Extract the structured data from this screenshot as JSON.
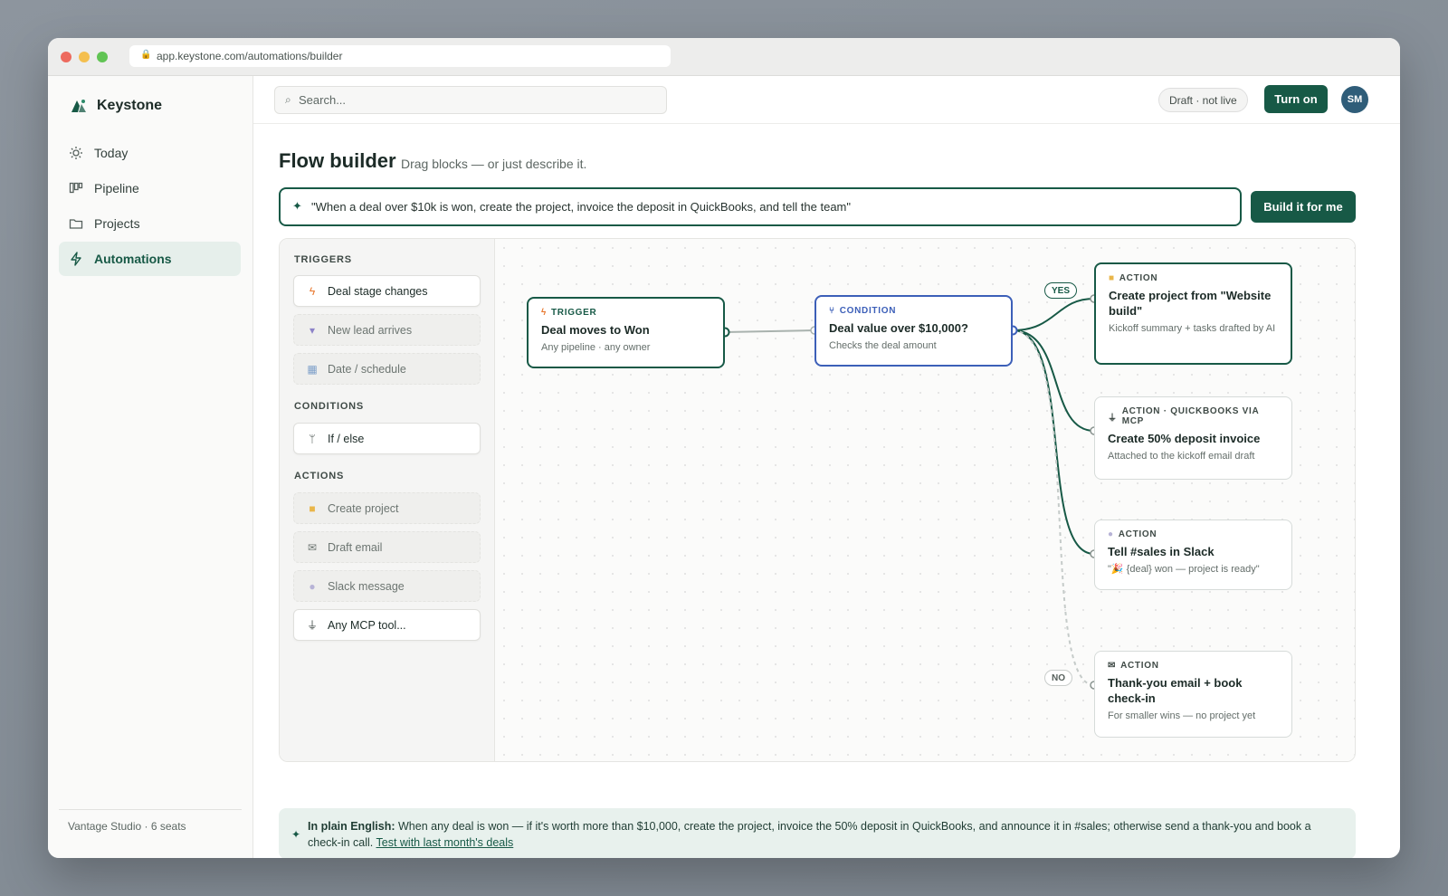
{
  "browser": {
    "url": "app.keystone.com/automations/builder"
  },
  "sidebar": {
    "brand": "Keystone",
    "items": [
      {
        "label": "Today",
        "icon": "sun-icon"
      },
      {
        "label": "Pipeline",
        "icon": "kanban-icon"
      },
      {
        "label": "Projects",
        "icon": "folder-icon"
      },
      {
        "label": "Automations",
        "icon": "bolt-icon",
        "active": true
      }
    ],
    "workspace": "Vantage Studio · 6 seats"
  },
  "topbar": {
    "search_placeholder": "Search...",
    "status": "Draft · not live",
    "turn_on": "Turn on",
    "avatar": "SM"
  },
  "page": {
    "title": "Flow builder",
    "subtitle": "Drag blocks — or just describe it.",
    "prompt": "\"When a deal over $10k is won, create the project, invoice the deposit in QuickBooks, and tell the team\"",
    "build_button": "Build it for me"
  },
  "palette": {
    "triggers_title": "TRIGGERS",
    "triggers": [
      {
        "label": "Deal stage changes",
        "icon": "bolt-icon",
        "enabled": true
      },
      {
        "label": "New lead arrives",
        "icon": "inbox-icon",
        "enabled": false
      },
      {
        "label": "Date / schedule",
        "icon": "calendar-icon",
        "enabled": false
      }
    ],
    "conditions_title": "CONDITIONS",
    "conditions": [
      {
        "label": "If / else",
        "icon": "branch-icon",
        "enabled": true
      }
    ],
    "actions_title": "ACTIONS",
    "actions": [
      {
        "label": "Create project",
        "icon": "folder-icon",
        "enabled": false
      },
      {
        "label": "Draft email",
        "icon": "mail-icon",
        "enabled": false
      },
      {
        "label": "Slack message",
        "icon": "chat-icon",
        "enabled": false
      },
      {
        "label": "Any MCP tool...",
        "icon": "plug-icon",
        "enabled": true
      }
    ]
  },
  "flow": {
    "trigger": {
      "tag": "TRIGGER",
      "title": "Deal moves to Won",
      "sub": "Any pipeline · any owner"
    },
    "condition": {
      "tag": "CONDITION",
      "title": "Deal value over $10,000?",
      "sub": "Checks the deal amount"
    },
    "yes_label": "YES",
    "no_label": "NO",
    "actions": [
      {
        "tag": "ACTION",
        "title": "Create project from \"Website build\"",
        "sub": "Kickoff summary + tasks drafted by AI"
      },
      {
        "tag": "ACTION · QUICKBOOKS VIA MCP",
        "title": "Create 50% deposit invoice",
        "sub": "Attached to the kickoff email draft"
      },
      {
        "tag": "ACTION",
        "title": "Tell #sales in Slack",
        "sub": "\"🎉 {deal} won — project is ready\""
      },
      {
        "tag": "ACTION",
        "title": "Thank-you email + book check-in",
        "sub": "For smaller wins — no project yet"
      }
    ]
  },
  "plain_english": {
    "label": "In plain English:",
    "text": " When any deal is won — if it's worth more than $10,000, create the project, invoice the 50% deposit in QuickBooks, and announce it in #sales; otherwise send a thank-you and book a check-in call. ",
    "link": "Test with last month's deals"
  },
  "colors": {
    "accent": "#175946",
    "condition": "#3c5fb8",
    "trigger_icon": "#e8762c"
  }
}
